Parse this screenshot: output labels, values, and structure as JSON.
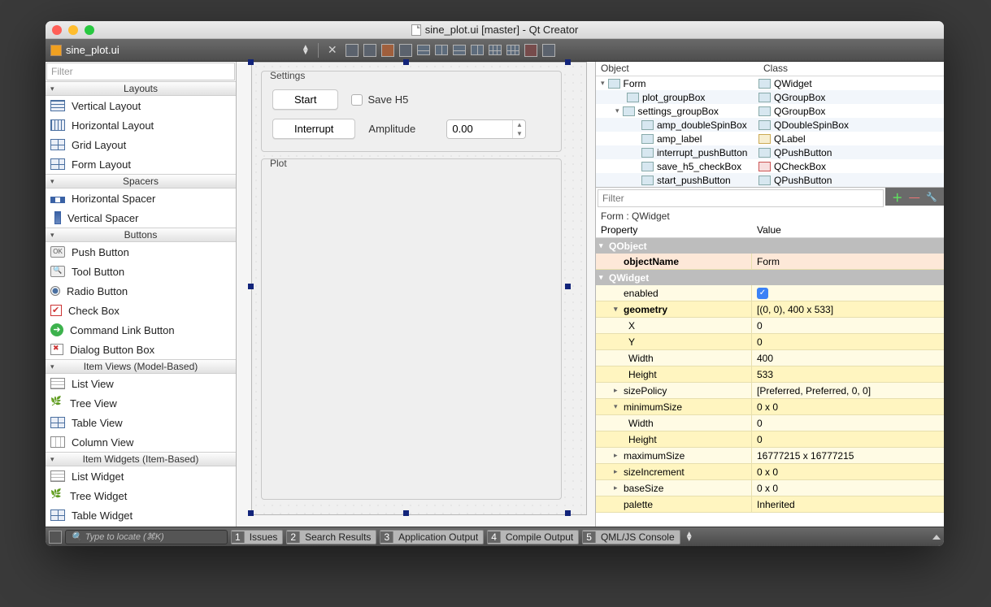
{
  "title": "sine_plot.ui [master] - Qt Creator",
  "tab_filename": "sine_plot.ui",
  "filter_placeholder": "Filter",
  "widgetbox": {
    "sections": [
      {
        "title": "Layouts",
        "items": [
          "Vertical Layout",
          "Horizontal Layout",
          "Grid Layout",
          "Form Layout"
        ]
      },
      {
        "title": "Spacers",
        "items": [
          "Horizontal Spacer",
          "Vertical Spacer"
        ]
      },
      {
        "title": "Buttons",
        "items": [
          "Push Button",
          "Tool Button",
          "Radio Button",
          "Check Box",
          "Command Link Button",
          "Dialog Button Box"
        ]
      },
      {
        "title": "Item Views (Model-Based)",
        "items": [
          "List View",
          "Tree View",
          "Table View",
          "Column View"
        ]
      },
      {
        "title": "Item Widgets (Item-Based)",
        "items": [
          "List Widget",
          "Tree Widget",
          "Table Widget"
        ]
      }
    ]
  },
  "form": {
    "settings": {
      "title": "Settings",
      "start_label": "Start",
      "save_h5_label": "Save H5",
      "interrupt_label": "Interrupt",
      "amplitude_label": "Amplitude",
      "amplitude_value": "0.00"
    },
    "plot": {
      "title": "Plot"
    }
  },
  "object_inspector": {
    "headers": {
      "object": "Object",
      "class": "Class"
    },
    "rows": [
      {
        "indent": 0,
        "disc": "open",
        "name": "Form",
        "class": "QWidget"
      },
      {
        "indent": 1,
        "disc": "",
        "name": "plot_groupBox",
        "class": "QGroupBox"
      },
      {
        "indent": 1,
        "disc": "open",
        "name": "settings_groupBox",
        "class": "QGroupBox"
      },
      {
        "indent": 2,
        "disc": "",
        "name": "amp_doubleSpinBox",
        "class": "QDoubleSpinBox"
      },
      {
        "indent": 2,
        "disc": "",
        "name": "amp_label",
        "class": "QLabel"
      },
      {
        "indent": 2,
        "disc": "",
        "name": "interrupt_pushButton",
        "class": "QPushButton"
      },
      {
        "indent": 2,
        "disc": "",
        "name": "save_h5_checkBox",
        "class": "QCheckBox"
      },
      {
        "indent": 2,
        "disc": "",
        "name": "start_pushButton",
        "class": "QPushButton"
      }
    ]
  },
  "property_editor": {
    "filter_placeholder": "Filter",
    "context": "Form : QWidget",
    "headers": {
      "property": "Property",
      "value": "Value"
    },
    "groups": [
      {
        "name": "QObject",
        "rows": [
          {
            "prop": "objectName",
            "value": "Form",
            "bold": true,
            "indent": 1
          }
        ]
      },
      {
        "name": "QWidget",
        "rows": [
          {
            "prop": "enabled",
            "value": "[check]",
            "indent": 1
          },
          {
            "prop": "geometry",
            "value": "[(0, 0), 400 x 533]",
            "bold": true,
            "disc": "open",
            "indent": 1
          },
          {
            "prop": "X",
            "value": "0",
            "indent": 2
          },
          {
            "prop": "Y",
            "value": "0",
            "indent": 2
          },
          {
            "prop": "Width",
            "value": "400",
            "indent": 2
          },
          {
            "prop": "Height",
            "value": "533",
            "indent": 2
          },
          {
            "prop": "sizePolicy",
            "value": "[Preferred, Preferred, 0, 0]",
            "disc": "clo",
            "indent": 1
          },
          {
            "prop": "minimumSize",
            "value": "0 x 0",
            "disc": "open",
            "indent": 1
          },
          {
            "prop": "Width",
            "value": "0",
            "indent": 2
          },
          {
            "prop": "Height",
            "value": "0",
            "indent": 2
          },
          {
            "prop": "maximumSize",
            "value": "16777215 x 16777215",
            "disc": "clo",
            "indent": 1
          },
          {
            "prop": "sizeIncrement",
            "value": "0 x 0",
            "disc": "clo",
            "indent": 1
          },
          {
            "prop": "baseSize",
            "value": "0 x 0",
            "disc": "clo",
            "indent": 1
          },
          {
            "prop": "palette",
            "value": "Inherited",
            "indent": 1
          }
        ]
      }
    ]
  },
  "bottom": {
    "locate_placeholder": "Type to locate (⌘K)",
    "tabs": [
      {
        "n": "1",
        "t": "Issues"
      },
      {
        "n": "2",
        "t": "Search Results"
      },
      {
        "n": "3",
        "t": "Application Output"
      },
      {
        "n": "4",
        "t": "Compile Output"
      },
      {
        "n": "5",
        "t": "QML/JS Console"
      }
    ]
  }
}
